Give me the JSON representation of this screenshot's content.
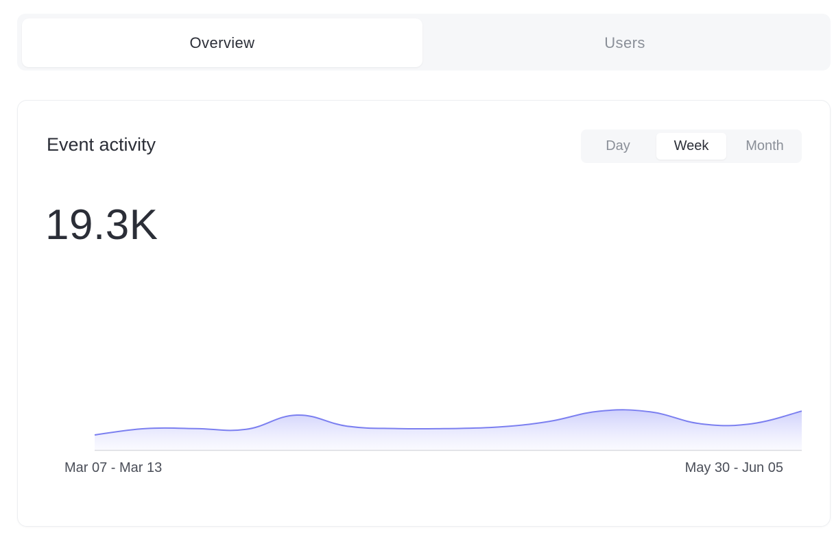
{
  "tabs": [
    {
      "label": "Overview",
      "active": true
    },
    {
      "label": "Users",
      "active": false
    }
  ],
  "card": {
    "title": "Event activity",
    "periods": [
      {
        "label": "Day",
        "selected": false
      },
      {
        "label": "Week",
        "selected": true
      },
      {
        "label": "Month",
        "selected": false
      }
    ],
    "total": "19.3K"
  },
  "colors": {
    "series_line": "#7b7ff0",
    "series_fill_top": "#c9cbfb",
    "series_fill_bottom": "#f7f7ff",
    "baseline": "#d9dbe0"
  },
  "chart_data": {
    "type": "area",
    "x_labels_shown": [
      "Mar 07 - Mar 13",
      "May 30 - Jun 05"
    ],
    "x": [
      "Mar 07 - Mar 13",
      "",
      "",
      "",
      "",
      "",
      "",
      "",
      "",
      "",
      "",
      "",
      "",
      "May 30 - Jun 05"
    ],
    "values": [
      1.9,
      2.7,
      2.7,
      2.6,
      4.4,
      3.0,
      2.7,
      2.7,
      2.9,
      3.6,
      4.9,
      4.8,
      3.3,
      3.3,
      4.9
    ],
    "ylim": [
      0,
      25
    ],
    "grid": false,
    "legend": "none"
  }
}
